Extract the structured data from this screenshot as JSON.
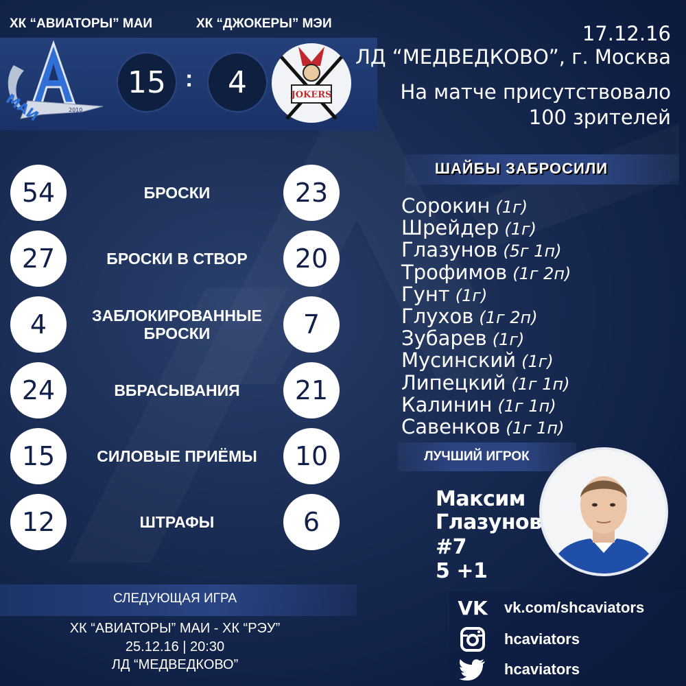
{
  "teams": {
    "home_label": "ХК “АВИАТОРЫ” МАИ",
    "away_label": "ХК “ДЖОКЕРЫ” МЭИ",
    "home_logo_text": "МАИ",
    "home_logo_year": "2010",
    "away_logo_text": "JOKERS"
  },
  "score": {
    "home": "15",
    "separator": ":",
    "away": "4"
  },
  "match_info": {
    "date": "17.12.16",
    "venue": "ЛД “МЕДВЕДКОВО”, г. Москва",
    "attendance_line1": "На матче присутствовало",
    "attendance_line2": "100 зрителей"
  },
  "stats": [
    {
      "home": "54",
      "label": "БРОСКИ",
      "away": "23"
    },
    {
      "home": "27",
      "label": "БРОСКИ В СТВОР",
      "away": "20"
    },
    {
      "home": "4",
      "label": "ЗАБЛОКИРОВАННЫЕ БРОСКИ",
      "away": "7"
    },
    {
      "home": "24",
      "label": "ВБРАСЫВАНИЯ",
      "away": "21"
    },
    {
      "home": "15",
      "label": "СИЛОВЫЕ ПРИЁМЫ",
      "away": "10"
    },
    {
      "home": "12",
      "label": "ШТРАФЫ",
      "away": "6"
    }
  ],
  "scorers": {
    "title": "ШАЙБЫ ЗАБРОСИЛИ",
    "items": [
      {
        "name": "Сорокин",
        "stats": "(1г)"
      },
      {
        "name": "Шрейдер",
        "stats": "(1г)"
      },
      {
        "name": "Глазунов",
        "stats": "(5г 1п)"
      },
      {
        "name": "Трофимов",
        "stats": "(1г 2п)"
      },
      {
        "name": "Гунт",
        "stats": "(1г)"
      },
      {
        "name": "Глухов",
        "stats": "(1г 2п)"
      },
      {
        "name": "Зубарев",
        "stats": "(1г)"
      },
      {
        "name": "Мусинский",
        "stats": "(1г)"
      },
      {
        "name": "Липецкий",
        "stats": "(1г 1п)"
      },
      {
        "name": "Калинин",
        "stats": "(1г 1п)"
      },
      {
        "name": "Савенков",
        "stats": "(1г 1п)"
      }
    ]
  },
  "best_player": {
    "title": "ЛУЧШИЙ ИГРОК",
    "first_name": "Максим",
    "last_name": "Глазунов",
    "number": "#7",
    "points": "5 +1"
  },
  "next_game": {
    "title": "СЛЕДУЮЩАЯ ИГРА",
    "match": "ХК “АВИАТОРЫ” МАИ - ХК “РЭУ”",
    "datetime": "25.12.16 | 20:30",
    "venue": "ЛД “МЕДВЕДКОВО”"
  },
  "social": {
    "vk": {
      "icon": "vk-icon",
      "text": "vk.com/shcaviators"
    },
    "instagram": {
      "icon": "instagram-icon",
      "text": "hcaviators"
    },
    "twitter": {
      "icon": "twitter-icon",
      "text": "hcaviators"
    }
  },
  "colors": {
    "background": "#1b2d55",
    "band": "#24407a",
    "stat_circle": "#ffffff",
    "stat_number": "#10204a"
  }
}
